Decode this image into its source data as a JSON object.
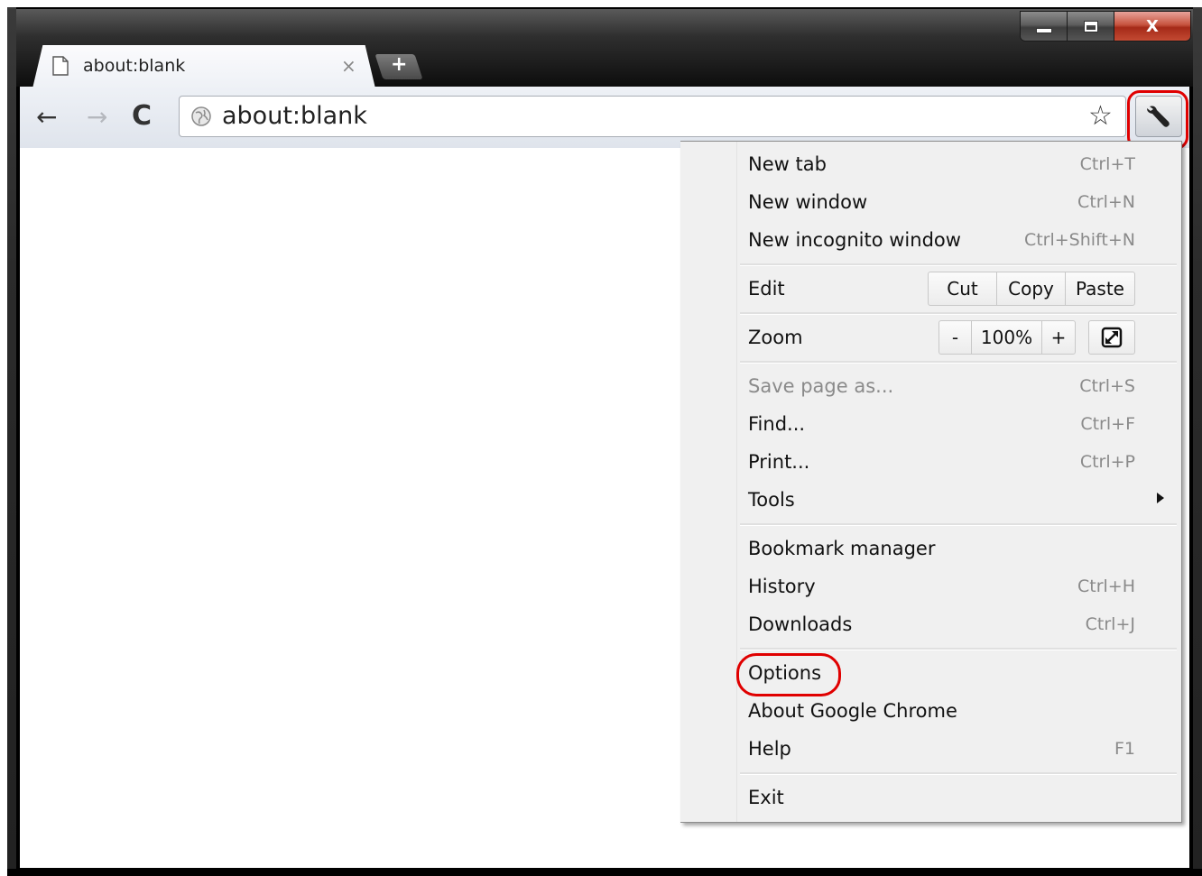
{
  "tab": {
    "title": "about:blank",
    "close_glyph": "×",
    "new_tab_glyph": "+"
  },
  "window_controls": {
    "close_glyph": "X"
  },
  "toolbar": {
    "back_glyph": "←",
    "forward_glyph": "→",
    "reload_glyph": "C",
    "url": "about:blank",
    "star_glyph": "☆"
  },
  "menu": {
    "new_tab": {
      "label": "New tab",
      "shortcut": "Ctrl+T"
    },
    "new_window": {
      "label": "New window",
      "shortcut": "Ctrl+N"
    },
    "new_incognito": {
      "label": "New incognito window",
      "shortcut": "Ctrl+Shift+N"
    },
    "edit": {
      "label": "Edit",
      "cut": "Cut",
      "copy": "Copy",
      "paste": "Paste"
    },
    "zoom": {
      "label": "Zoom",
      "minus": "-",
      "value": "100%",
      "plus": "+"
    },
    "save_page": {
      "label": "Save page as...",
      "shortcut": "Ctrl+S"
    },
    "find": {
      "label": "Find...",
      "shortcut": "Ctrl+F"
    },
    "print": {
      "label": "Print...",
      "shortcut": "Ctrl+P"
    },
    "tools": {
      "label": "Tools"
    },
    "bookmark_manager": {
      "label": "Bookmark manager"
    },
    "history": {
      "label": "History",
      "shortcut": "Ctrl+H"
    },
    "downloads": {
      "label": "Downloads",
      "shortcut": "Ctrl+J"
    },
    "options": {
      "label": "Options"
    },
    "about": {
      "label": "About Google Chrome"
    },
    "help": {
      "label": "Help",
      "shortcut": "F1"
    },
    "exit": {
      "label": "Exit"
    }
  },
  "annotation_color": "#e00000"
}
